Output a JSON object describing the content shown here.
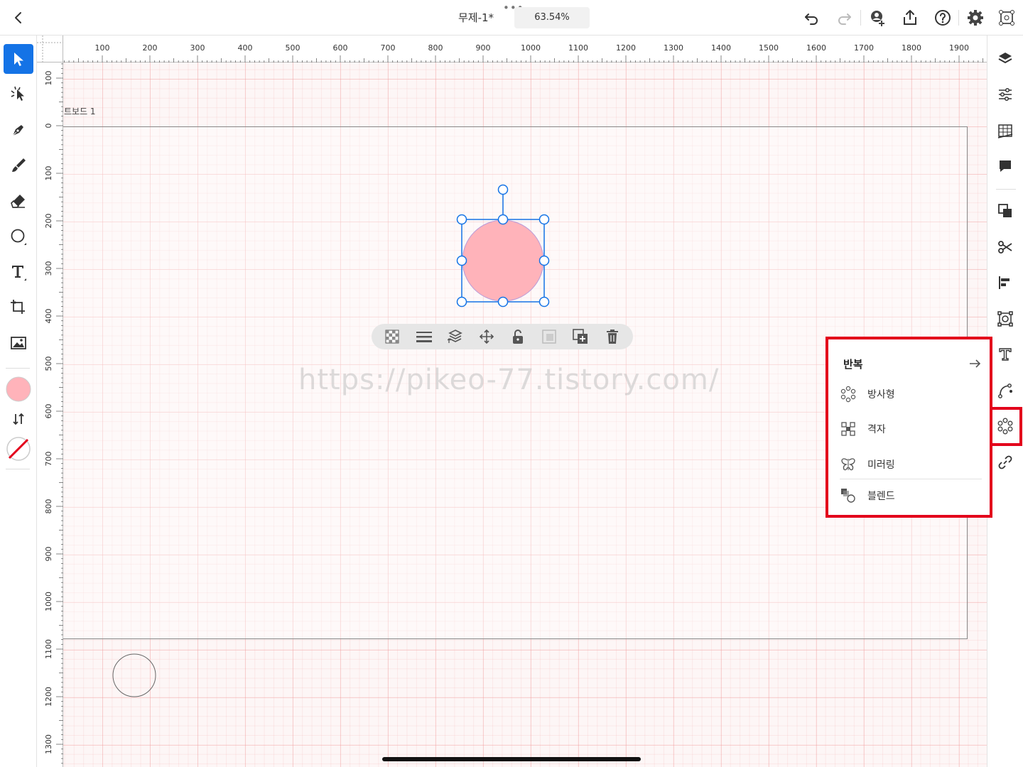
{
  "topbar": {
    "title": "무제-1*",
    "more_dots": "•••",
    "zoom": "63.54%"
  },
  "ruler": {
    "top_labels": [
      "100",
      "200",
      "300",
      "400",
      "500",
      "600",
      "700",
      "800",
      "900",
      "1000",
      "1100",
      "1200",
      "1300",
      "1400",
      "1500",
      "1600",
      "1700",
      "1800",
      "1900"
    ],
    "left_labels": [
      "100",
      "0",
      "100",
      "200",
      "300",
      "400",
      "500",
      "600",
      "700",
      "800",
      "900",
      "1000",
      "1100",
      "1200",
      "1300"
    ]
  },
  "canvas": {
    "artboard_label": "트보드 1",
    "watermark": "https://pikeo-77.tistory.com/",
    "fill_color": "#ffb3ba",
    "selection_color": "#1473e6"
  },
  "repeat_menu": {
    "title": "반복",
    "items": [
      {
        "label": "방사형",
        "icon": "radial-repeat-icon"
      },
      {
        "label": "격자",
        "icon": "grid-repeat-icon"
      },
      {
        "label": "미러링",
        "icon": "mirror-repeat-icon"
      },
      {
        "label": "블렌드",
        "icon": "blend-icon"
      }
    ]
  },
  "colors": {
    "accent": "#1473e6",
    "highlight": "#e3001b",
    "fill_swatch": "#ffb3ba"
  }
}
